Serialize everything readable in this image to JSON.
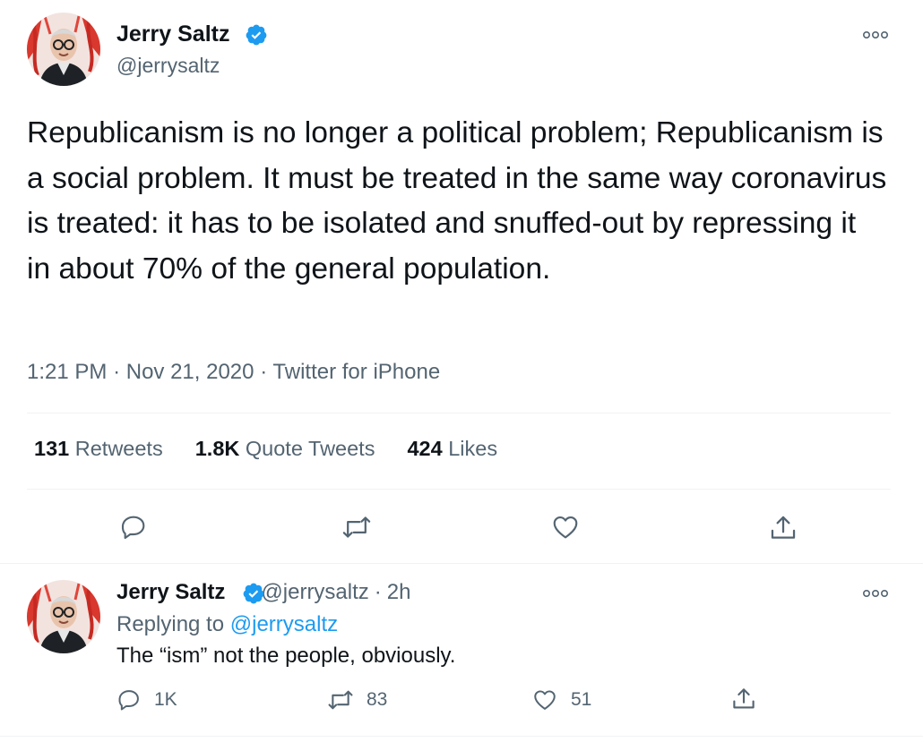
{
  "colors": {
    "accent": "#1d9bf0",
    "secondary_text": "#536471",
    "primary_text": "#0f1419",
    "like_red": "#f91880"
  },
  "main_tweet": {
    "author_name": "Jerry Saltz",
    "author_handle": "@jerrysaltz",
    "verified_icon": "verified-badge-icon",
    "more_icon": "more-options-icon",
    "text": "Republicanism is no longer a political problem; Republicanism is a social problem. It must be treated in the same way coronavirus is treated: it has to be isolated and snuffed-out by repressing it in about 70% of the general population.",
    "time": "1:21 PM",
    "date": "Nov 21, 2020",
    "source": "Twitter for iPhone",
    "stats": {
      "retweets_count": "131",
      "retweets_label": "Retweets",
      "quote_count": "1.8K",
      "quote_label": "Quote Tweets",
      "likes_count": "424",
      "likes_label": "Likes"
    },
    "actions": [
      "reply-icon",
      "retweet-icon",
      "like-icon",
      "share-icon"
    ]
  },
  "reply_tweet": {
    "author_name": "Jerry Saltz",
    "author_handle": "@jerrysaltz",
    "separator": "·",
    "time": "2h",
    "replying_prefix": "Replying to",
    "replying_to": "@jerrysaltz",
    "text": "The “ism” not the people, obviously.",
    "reply_count": "1K",
    "retweet_count": "83",
    "like_count": "51"
  }
}
